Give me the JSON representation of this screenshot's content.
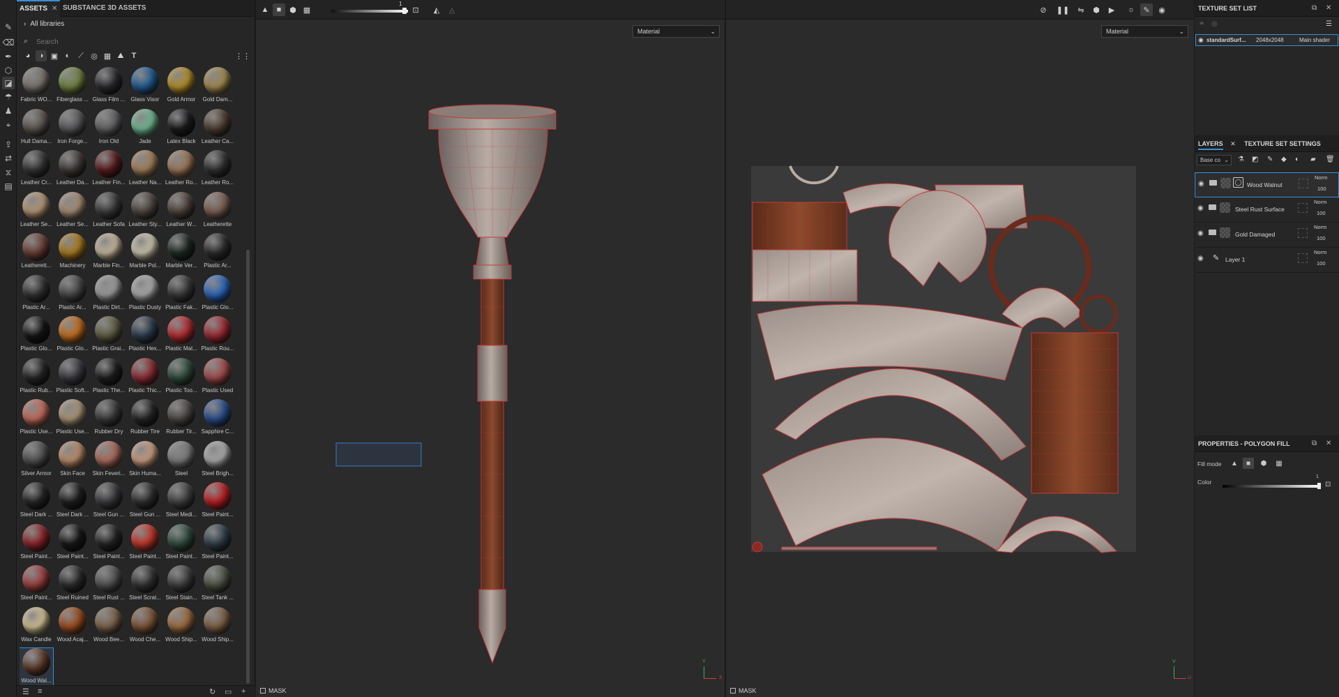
{
  "toolbar_left": {
    "tools": [
      "paint-brush-icon",
      "eraser-icon",
      "projection-icon",
      "geometry-mask-icon",
      "polygon-fill-icon",
      "smudge-icon",
      "clone-icon",
      "material-picker-icon",
      "bake-icon",
      "export-icon",
      "transform-icon",
      "record-icon",
      "document-icon"
    ]
  },
  "assets": {
    "tabs": [
      {
        "label": "ASSETS",
        "close": "✕"
      },
      {
        "label": "SUBSTANCE 3D ASSETS"
      }
    ],
    "libraries_label": "All libraries",
    "search_placeholder": "Search",
    "filter_icons": [
      "materials-filter-icon",
      "smart-materials-filter-icon",
      "textures-filter-icon",
      "alpha-filter-icon",
      "brush-filter-icon",
      "particles-filter-icon",
      "environment-filter-icon",
      "image-filter-icon",
      "font-filter-icon",
      "grid-view-icon"
    ],
    "materials": [
      {
        "label": "Fabric WO...",
        "color": "#77726a"
      },
      {
        "label": "Fiberglass ...",
        "color": "#6f8040"
      },
      {
        "label": "Glass Film ...",
        "color": "#2a2a2e"
      },
      {
        "label": "Glass Visor",
        "color": "#1f5a8f"
      },
      {
        "label": "Gold Armor",
        "color": "#b08c28"
      },
      {
        "label": "Gold Dam...",
        "color": "#a08850"
      },
      {
        "label": "Hull Dama...",
        "color": "#5a5550"
      },
      {
        "label": "Iron Forge...",
        "color": "#58585a"
      },
      {
        "label": "Iron Old",
        "color": "#606062"
      },
      {
        "label": "Jade",
        "color": "#6fb590"
      },
      {
        "label": "Latex Black",
        "color": "#1c1c1e"
      },
      {
        "label": "Leather Ca...",
        "color": "#4e3e32"
      },
      {
        "label": "Leather Cr...",
        "color": "#353535"
      },
      {
        "label": "Leather Da...",
        "color": "#3e3a38"
      },
      {
        "label": "Leather Fin...",
        "color": "#5a1c1e"
      },
      {
        "label": "Leather Na...",
        "color": "#a07e5a"
      },
      {
        "label": "Leather Ro...",
        "color": "#9a7656"
      },
      {
        "label": "Leather Ro...",
        "color": "#303030"
      },
      {
        "label": "Leather Se...",
        "color": "#b29476"
      },
      {
        "label": "Leather Se...",
        "color": "#a48a74"
      },
      {
        "label": "Leather Sofa",
        "color": "#3a3a3a"
      },
      {
        "label": "Leather Sty...",
        "color": "#4c4440"
      },
      {
        "label": "Leather W...",
        "color": "#4e403a"
      },
      {
        "label": "Leatherette",
        "color": "#7a5e50"
      },
      {
        "label": "Leatherett...",
        "color": "#6a3e36"
      },
      {
        "label": "Machinery",
        "color": "#a87a20"
      },
      {
        "label": "Marble Fin...",
        "color": "#c4b49a"
      },
      {
        "label": "Marble Pol...",
        "color": "#c8c0aa"
      },
      {
        "label": "Marble Ver...",
        "color": "#1e2a24"
      },
      {
        "label": "Plastic Ar...",
        "color": "#2c2c2c"
      },
      {
        "label": "Plastic Ar...",
        "color": "#333333"
      },
      {
        "label": "Plastic Ar...",
        "color": "#474747"
      },
      {
        "label": "Plastic Dirt...",
        "color": "#9a9a9a"
      },
      {
        "label": "Plastic Dusty",
        "color": "#a8a8a8"
      },
      {
        "label": "Plastic Fak...",
        "color": "#383838"
      },
      {
        "label": "Plastic Glo...",
        "color": "#2c66b8"
      },
      {
        "label": "Plastic Glo...",
        "color": "#151515"
      },
      {
        "label": "Plastic Glo...",
        "color": "#c06a1c"
      },
      {
        "label": "Plastic Grai...",
        "color": "#5c5a40"
      },
      {
        "label": "Plastic Hex...",
        "color": "#2a3a4a"
      },
      {
        "label": "Plastic Mat...",
        "color": "#b02a30"
      },
      {
        "label": "Plastic Rou...",
        "color": "#9a2830"
      },
      {
        "label": "Plastic Rub...",
        "color": "#262626"
      },
      {
        "label": "Plastic Soft...",
        "color": "#3a3a40"
      },
      {
        "label": "Plastic The...",
        "color": "#1e1e1e"
      },
      {
        "label": "Plastic Thic...",
        "color": "#8a2c32"
      },
      {
        "label": "Plastic Too...",
        "color": "#2e4a3c"
      },
      {
        "label": "Plastic Used",
        "color": "#a04a4a"
      },
      {
        "label": "Plastic Use...",
        "color": "#c06a5a"
      },
      {
        "label": "Plastic Use...",
        "color": "#a89276"
      },
      {
        "label": "Rubber Dry",
        "color": "#3a3a3a"
      },
      {
        "label": "Rubber Tire",
        "color": "#262626"
      },
      {
        "label": "Rubber Tir...",
        "color": "#4a4644"
      },
      {
        "label": "Sapphire C...",
        "color": "#2a4e8a"
      },
      {
        "label": "Silver Armor",
        "color": "#505050"
      },
      {
        "label": "Skin Face",
        "color": "#b88a6a"
      },
      {
        "label": "Skin Feveri...",
        "color": "#a86a5a"
      },
      {
        "label": "Skin Huma...",
        "color": "#c69a80"
      },
      {
        "label": "Steel",
        "color": "#7a7a7a"
      },
      {
        "label": "Steel Brigh...",
        "color": "#a8a8a8"
      },
      {
        "label": "Steel Dark ...",
        "color": "#252525"
      },
      {
        "label": "Steel Dark ...",
        "color": "#1e1e1e"
      },
      {
        "label": "Steel Gun ...",
        "color": "#3a3a3c"
      },
      {
        "label": "Steel Gun ...",
        "color": "#2e2e30"
      },
      {
        "label": "Steel Medi...",
        "color": "#404040"
      },
      {
        "label": "Steel Paint...",
        "color": "#b81e22"
      },
      {
        "label": "Steel Paint...",
        "color": "#8a2428"
      },
      {
        "label": "Steel Paint...",
        "color": "#181818"
      },
      {
        "label": "Steel Paint...",
        "color": "#242424"
      },
      {
        "label": "Steel Paint...",
        "color": "#c03428"
      },
      {
        "label": "Steel Paint...",
        "color": "#2e4a3e"
      },
      {
        "label": "Steel Paint...",
        "color": "#2e3e48"
      },
      {
        "label": "Steel Paint...",
        "color": "#9a3e3e"
      },
      {
        "label": "Steel Ruined",
        "color": "#2c2c2c"
      },
      {
        "label": "Steel Rust ...",
        "color": "#505050"
      },
      {
        "label": "Steel Scrat...",
        "color": "#333333"
      },
      {
        "label": "Steel Stain...",
        "color": "#3e3e3e"
      },
      {
        "label": "Steel Tank ...",
        "color": "#4e5244"
      },
      {
        "label": "Wax Candle",
        "color": "#d0be92"
      },
      {
        "label": "Wood Acaj...",
        "color": "#9a4a1e"
      },
      {
        "label": "Wood Bee...",
        "color": "#7a6048"
      },
      {
        "label": "Wood Che...",
        "color": "#7a5236"
      },
      {
        "label": "Wood Ship...",
        "color": "#9a6a3e"
      },
      {
        "label": "Wood Ship...",
        "color": "#7a5e44"
      },
      {
        "label": "Wood Wal...",
        "color": "#5e3c2a"
      }
    ],
    "selected_index": 84
  },
  "viewport3d": {
    "top_icons": [
      "triangle-mode-icon",
      "solid-mode-icon",
      "cube-mode-icon",
      "checker-mode-icon"
    ],
    "slider_value": "1",
    "mirror_icons": [
      "symmetry-icon",
      "symmetry-off-icon"
    ],
    "dropdown": "Material",
    "mask_label": "MASK",
    "axis_labels": [
      "Y",
      "X"
    ]
  },
  "viewport2d": {
    "top_icons": [
      "hide-uv-icon",
      "pause-icon",
      "camera-split-icon",
      "cube-view-icon",
      "camera-icon",
      "rotate-light-icon",
      "paint-mode-icon",
      "screenshot-icon"
    ],
    "dropdown": "Material",
    "mask_label": "MASK",
    "axis_labels": [
      "V",
      "U"
    ]
  },
  "texture_set_list": {
    "title": "TEXTURE SET LIST",
    "set_name": "standardSurf...",
    "resolution": "2048x2048",
    "shader": "Main shader"
  },
  "layers_panel": {
    "tabs": [
      "LAYERS",
      "TEXTURE SET SETTINGS"
    ],
    "channel": "Base co",
    "layers": [
      {
        "name": "Wood Walnut",
        "blend": "Norm",
        "opacity": "100",
        "type": "fill",
        "selected": true
      },
      {
        "name": "Steel Rust Surface",
        "blend": "Norm",
        "opacity": "100",
        "type": "fill",
        "selected": false
      },
      {
        "name": "Gold Damaged",
        "blend": "Norm",
        "opacity": "100",
        "type": "fill",
        "selected": false
      },
      {
        "name": "Layer 1",
        "blend": "Norm",
        "opacity": "100",
        "type": "paint",
        "selected": false
      }
    ]
  },
  "properties": {
    "title": "PROPERTIES - POLYGON FILL",
    "fill_mode_label": "Fill mode",
    "color_label": "Color",
    "color_value": "1"
  }
}
